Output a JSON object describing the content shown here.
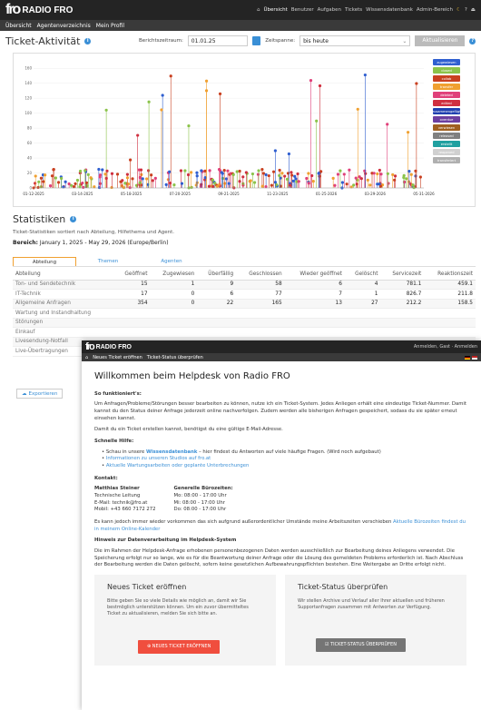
{
  "back": {
    "logo_text": "RADIO FRO",
    "nav": [
      "Übersicht",
      "Benutzer",
      "Aufgaben",
      "Tickets",
      "Wissensdatenbank",
      "Admin-Bereich"
    ],
    "subnav": [
      "Übersicht",
      "Agentenverzeichnis",
      "Mein Profil"
    ],
    "ta_title": "Ticket-Aktivität",
    "range_label": "Berichtszeitraum:",
    "range_value": "01.01.25",
    "span_label": "Zeitspanne:",
    "span_value": "bis heute",
    "update_btn": "Aktualisieren",
    "stat_title": "Statistiken",
    "stat_sub": "Ticket-Statistiken sortiert nach Abteilung, Hilfethema und Agent.",
    "stat_range_bold": "Bereich:",
    "stat_range": "January 1, 2025 - May 29, 2026 (Europe/Berlin)",
    "tabs": [
      "Abteilung",
      "Themen",
      "Agenten"
    ],
    "columns": [
      "Abteilung",
      "Geöffnet",
      "Zugewiesen",
      "Überfällig",
      "Geschlossen",
      "Wieder geöffnet",
      "Gelöscht",
      "Servicezeit",
      "Reaktionszeit"
    ],
    "rows": [
      [
        "Ton- und Sendetechnik",
        "15",
        "1",
        "9",
        "58",
        "6",
        "4",
        "781.1",
        "459.1"
      ],
      [
        "IT-Technik",
        "17",
        "0",
        "6",
        "77",
        "7",
        "1",
        "826.7",
        "211.8"
      ],
      [
        "Allgemeine Anfragen",
        "354",
        "0",
        "22",
        "165",
        "13",
        "27",
        "212.2",
        "158.5"
      ],
      [
        "Wartung und Instandhaltung",
        "",
        "",
        "",
        "",
        "",
        "",
        "",
        ""
      ],
      [
        "Störungen",
        "",
        "",
        "",
        "",
        "",
        "",
        "",
        ""
      ],
      [
        "Einkauf",
        "",
        "",
        "",
        "",
        "",
        "",
        "",
        ""
      ],
      [
        "Livesendung-Notfall",
        "",
        "",
        "",
        "",
        "",
        "",
        "",
        ""
      ],
      [
        "Live-Übertragungen",
        "",
        "",
        "",
        "",
        "",
        "",
        "",
        ""
      ]
    ],
    "export_btn": "Exportieren"
  },
  "chart_data": {
    "type": "scatter",
    "x_ticks": [
      "01-12-2025",
      "03-14-2025",
      "05-18-2025",
      "07-20-2025",
      "09-21-2025",
      "11-23-2025",
      "01-25-2026",
      "03-29-2026",
      "05-31-2026"
    ],
    "y_ticks": [
      160,
      140,
      120,
      100,
      80,
      60,
      40,
      20,
      0
    ],
    "ylim": [
      0,
      170
    ],
    "legend": [
      "zugewiesen",
      "closed",
      "collab",
      "transfer",
      "deleted",
      "edited",
      "zusammengefügt",
      "overdue",
      "verwiesen",
      "released",
      "erstellt",
      "reopened",
      "transferiert"
    ],
    "colors": [
      "#2f5fd0",
      "#8bc34a",
      "#c94020",
      "#f0a030",
      "#e0407a",
      "#d03040",
      "#2040b0",
      "#6c3fa0",
      "#a06020",
      "#808080",
      "#20a0a0",
      "#d0d0d0",
      "#b0b0b0"
    ]
  },
  "front": {
    "logo_text": "RADIO FRO",
    "user": "Anmelden, Gast · Anmelden",
    "subnav": [
      "Neues Ticket eröffnen",
      "Ticket-Status überprüfen"
    ],
    "h1": "Willkommen beim Helpdesk von Radio FRO",
    "how_title": "So funktioniert's:",
    "how_text": "Um Anfragen/Probleme/Störungen besser bearbeiten zu können, nutze ich ein Ticket-System. Jedes Anliegen erhält eine eindeutige Ticket-Nummer. Damit kannst du den Status deiner Anfrage jederzeit online nachverfolgen. Zudem werden alle bisherigen Anfragen gespeichert, sodass du sie später erneut einsehen kannst.",
    "how_text2": "Damit du ein Ticket erstellen kannst, benötigst du eine gültige E-Mail-Adresse.",
    "quick_title": "Schnelle Hilfe:",
    "quick_1a": "Schau in unsere ",
    "quick_1b": "Wissensdatenbank",
    "quick_1c": " – hier findest du Antworten auf viele häufige Fragen. (Wird noch aufgebaut)",
    "quick_2": "Informationen zu unseren Studios auf fro.at",
    "quick_3": "Aktuelle Wartungsarbeiten oder geplante Unterbrechungen",
    "contact_title": "Kontakt:",
    "contact_name": "Matthias Steiner",
    "contact_role": "Technische Leitung",
    "contact_mail": "E-Mail: technik@fro.at",
    "contact_phone": "Mobil: +43 660 7172 272",
    "office_title": "Generelle Bürozeiten:",
    "office_1": "Mo: 08:00 - 17:00 Uhr",
    "office_2": "Mi: 08:00 - 17:00 Uhr",
    "office_3": "Do: 08:00 - 17:00 Uhr",
    "note_text": "Es kann jedoch immer wieder vorkommen das sich aufgrund außerordentlicher Umstände meine Arbeitszeiten verschieben",
    "note_link": "Aktuelle Bürozeiten findest du in meinem Online-Kalender",
    "privacy_title": "Hinweis zur Datenverarbeitung im Helpdesk-System",
    "privacy_text": "Die im Rahmen der Helpdesk-Anfrage erhobenen personenbezogenen Daten werden ausschließlich zur Bearbeitung deines Anliegens verwendet. Die Speicherung erfolgt nur so lange, wie es für die Beantwortung deiner Anfrage oder die Lösung des gemeldeten Problems erforderlich ist. Nach Abschluss der Bearbeitung werden die Daten gelöscht, sofern keine gesetzlichen Aufbewahrungspflichten bestehen. Eine Weitergabe an Dritte erfolgt nicht.",
    "card1_title": "Neues Ticket eröffnen",
    "card1_text": "Bitte geben Sie so viele Details wie möglich an, damit wir Sie bestmöglich unterstützen können. Um ein zuvor übermitteltes Ticket zu aktualisieren, melden Sie sich bitte an.",
    "card1_btn": "NEUES TICKET ERÖFFNEN",
    "card2_title": "Ticket-Status überprüfen",
    "card2_text": "Wir stellen Archive und Verlauf aller Ihrer aktuellen und früheren Supportanfragen zusammen mit Antworten zur Verfügung.",
    "card2_btn": "TICKET-STATUS ÜBERPRÜFEN"
  }
}
